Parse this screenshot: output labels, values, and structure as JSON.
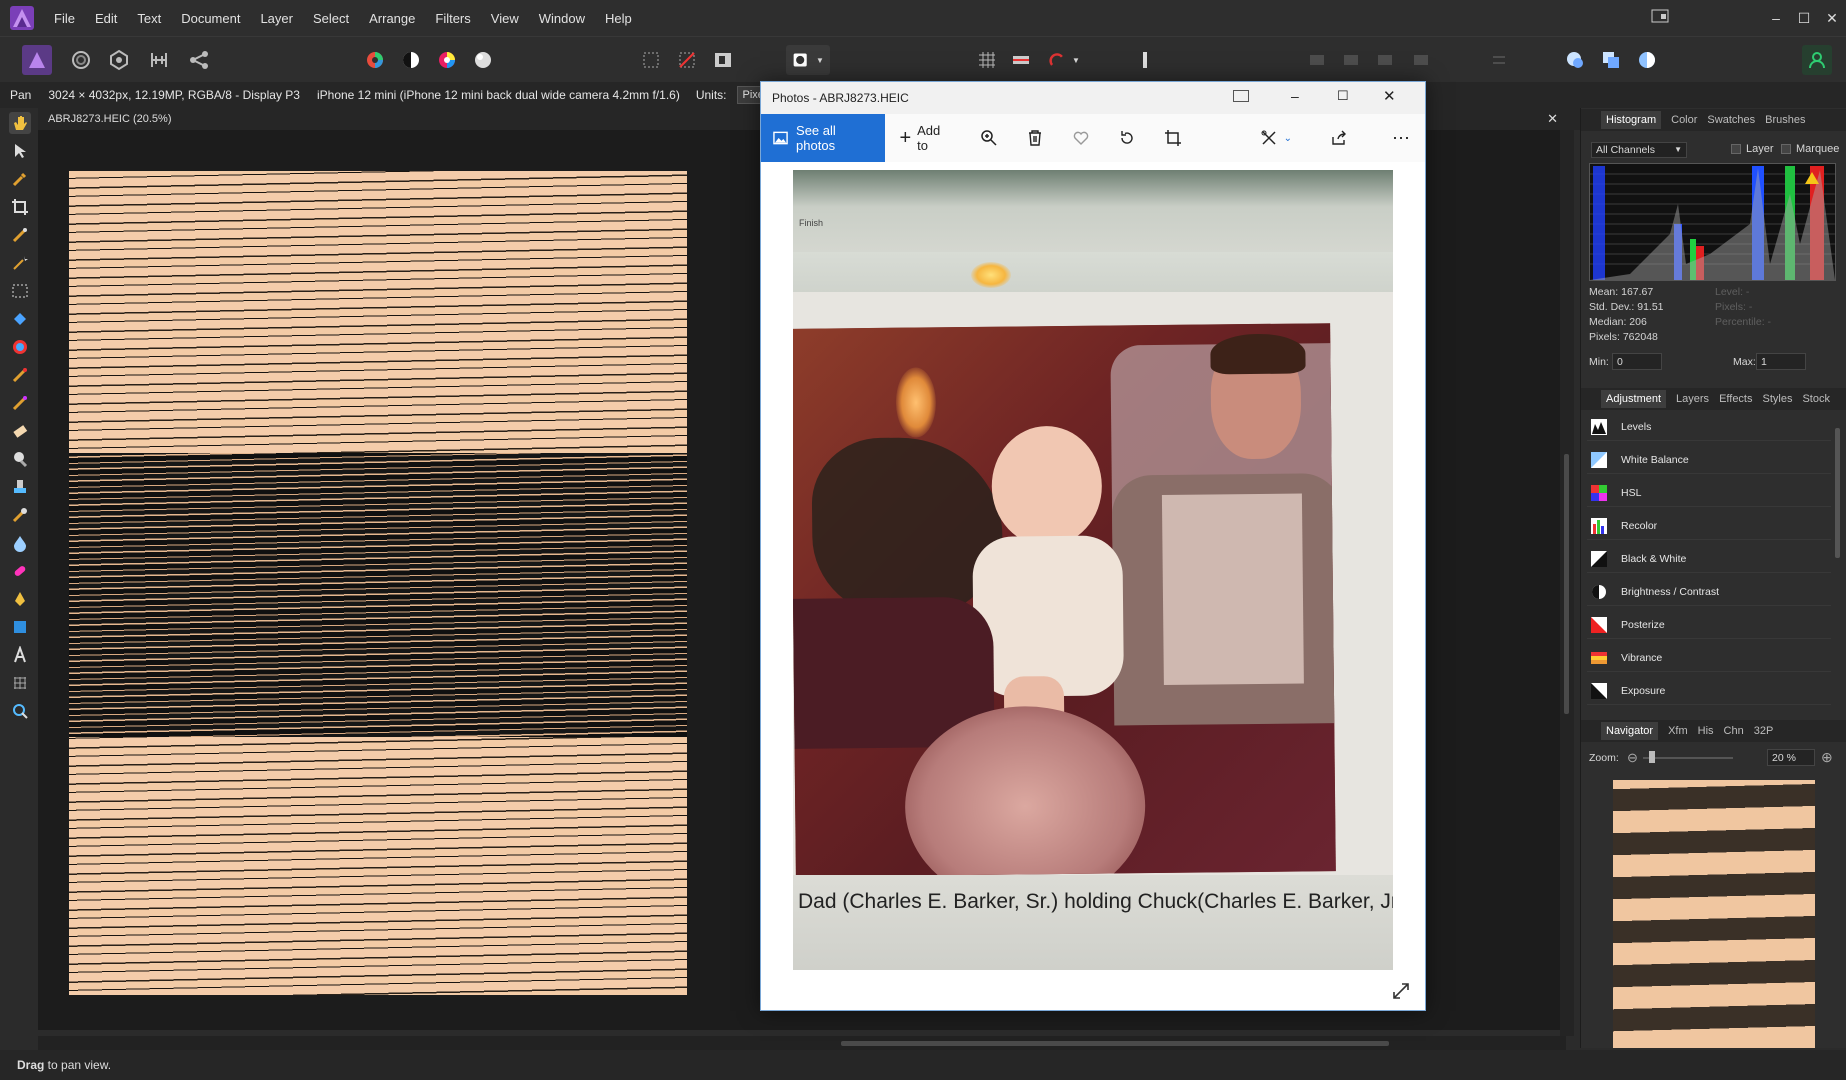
{
  "menu": [
    "File",
    "Edit",
    "Text",
    "Document",
    "Layer",
    "Select",
    "Arrange",
    "Filters",
    "View",
    "Window",
    "Help"
  ],
  "context": {
    "tool": "Pan",
    "info": "3024 × 4032px, 12.19MP, RGBA/8 - Display P3",
    "camera": "iPhone 12 mini (iPhone 12 mini back dual wide camera 4.2mm f/1.6)",
    "units_label": "Units:",
    "units_value": "Pixels"
  },
  "document": {
    "tab": "ABRJ8273.HEIC (20.5%)"
  },
  "photos": {
    "title": "Photos - ABRJ8273.HEIC",
    "see_all": "See all photos",
    "add_to": "Add to",
    "caption": "Dad (Charles E. Barker, Sr.) holding Chuck(Charles E. Barker, Jr",
    "frame_label": "Finish"
  },
  "histogram": {
    "tabs": [
      "Histogram",
      "Color",
      "Swatches",
      "Brushes"
    ],
    "channel": "All Channels",
    "layer_label": "Layer",
    "marquee_label": "Marquee",
    "mean": "Mean: 167.67",
    "std": "Std. Dev.: 91.51",
    "median": "Median: 206",
    "pixels": "Pixels: 762048",
    "level": "Level: -",
    "pixels2": "Pixels: -",
    "percentile": "Percentile: -",
    "min_label": "Min:",
    "min_value": "0",
    "max_label": "Max:",
    "max_value": "1"
  },
  "adjustment": {
    "tabs": [
      "Adjustment",
      "Layers",
      "Effects",
      "Styles",
      "Stock"
    ],
    "items": [
      "Levels",
      "White Balance",
      "HSL",
      "Recolor",
      "Black & White",
      "Brightness / Contrast",
      "Posterize",
      "Vibrance",
      "Exposure"
    ]
  },
  "navigator": {
    "tabs": [
      "Navigator",
      "Xfm",
      "His",
      "Chn",
      "32P"
    ],
    "zoom_label": "Zoom:",
    "zoom_value": "20 %"
  },
  "status": {
    "bold": "Drag",
    "text": " to pan view."
  },
  "colors": {
    "accent": "#1f6fd4",
    "app_bg": "#2e2e2e",
    "logo": "#7b3fb8"
  }
}
